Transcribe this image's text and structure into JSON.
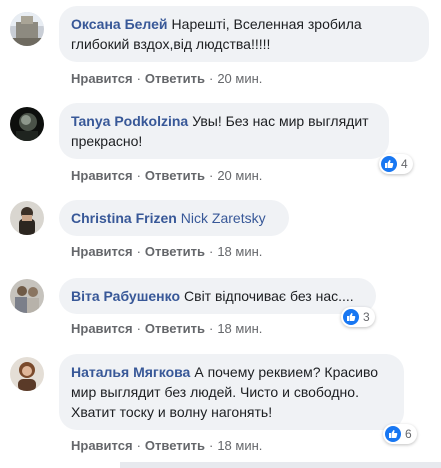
{
  "labels": {
    "like": "Нравится",
    "reply": "Ответить",
    "sep": "·"
  },
  "colors": {
    "author": "#385898",
    "bubble": "#f0f2f5",
    "like_badge": "#1877f2",
    "meta": "#65676b"
  },
  "comments": [
    {
      "author": "Оксана Белей",
      "text": "Нарешті, Вселенная зробила глибокий вздох,від людства!!!!!",
      "time": "20 мин."
    },
    {
      "author": "Tanya Podkolzina",
      "text": "Увы! Без нас мир выглядит прекрасно!",
      "time": "20 мин.",
      "reactions": "4"
    },
    {
      "author": "Christina Frizen",
      "mention": "Nick Zaretsky",
      "time": "18 мин."
    },
    {
      "author": "Віта Рабушенко",
      "text": "Світ відпочиває без нас....",
      "time": "18 мин.",
      "reactions": "3"
    },
    {
      "author": "Наталья Мягкова",
      "text": "А почему реквием? Красиво мир выглядит без людей. Чисто и свободно. Хватит тоску и волну нагонять!",
      "time": "18 мин.",
      "reactions": "6"
    }
  ]
}
